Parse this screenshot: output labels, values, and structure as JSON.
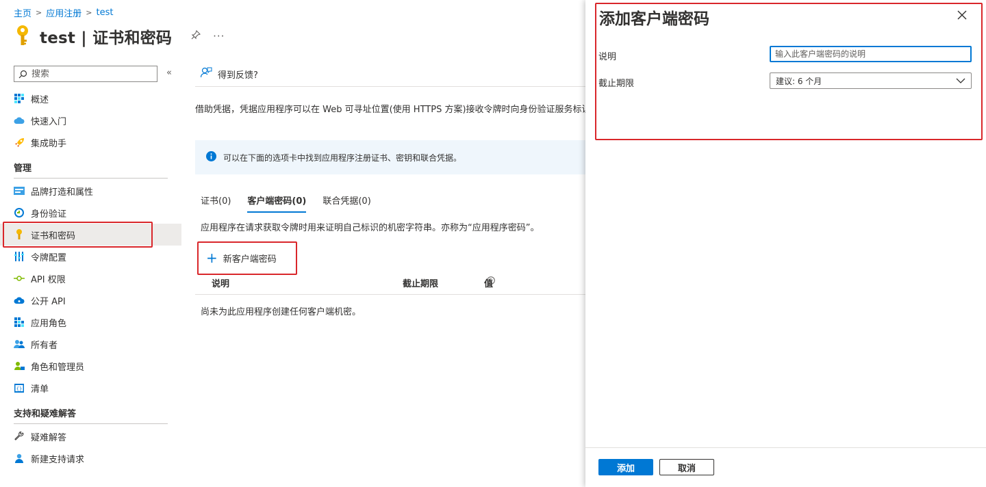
{
  "breadcrumb": {
    "home": "主页",
    "app_reg": "应用注册",
    "current": "test"
  },
  "page": {
    "title": "test | 证书和密码"
  },
  "sidebar": {
    "search_placeholder": "搜索",
    "items_top": [
      {
        "label": "概述",
        "icon": "grid-icon"
      },
      {
        "label": "快速入门",
        "icon": "cloud-icon"
      },
      {
        "label": "集成助手",
        "icon": "rocket-icon"
      }
    ],
    "group_manage": "管理",
    "items_manage": [
      {
        "label": "品牌打造和属性",
        "icon": "branding-icon"
      },
      {
        "label": "身份验证",
        "icon": "auth-icon"
      },
      {
        "label": "证书和密码",
        "icon": "key-icon"
      },
      {
        "label": "令牌配置",
        "icon": "token-icon"
      },
      {
        "label": "API 权限",
        "icon": "api-permission-icon"
      },
      {
        "label": "公开 API",
        "icon": "cloud-api-icon"
      },
      {
        "label": "应用角色",
        "icon": "app-roles-icon"
      },
      {
        "label": "所有者",
        "icon": "owners-icon"
      },
      {
        "label": "角色和管理员",
        "icon": "roles-admin-icon"
      },
      {
        "label": "清单",
        "icon": "manifest-icon"
      }
    ],
    "group_support": "支持和疑难解答",
    "items_support": [
      {
        "label": "疑难解答",
        "icon": "wrench-icon"
      },
      {
        "label": "新建支持请求",
        "icon": "support-person-icon"
      }
    ]
  },
  "main": {
    "feedback": "得到反馈?",
    "description": "借助凭据，凭据应用程序可以在 Web 可寻址位置(使用 HTTPS 方案)接收令牌时向身份验证服务标识自身。为了获得更高级别的保证",
    "info": "可以在下面的选项卡中找到应用程序注册证书、密钥和联合凭据。",
    "tabs": [
      {
        "label": "证书(0)"
      },
      {
        "label": "客户端密码(0)"
      },
      {
        "label": "联合凭据(0)"
      }
    ],
    "tab_description": "应用程序在请求获取令牌时用来证明自己标识的机密字符串。亦称为“应用程序密码”。",
    "new_secret": "新客户端密码",
    "columns": {
      "description": "说明",
      "expires": "截止期限",
      "value": "值"
    },
    "empty_message": "尚未为此应用程序创建任何客户端机密。"
  },
  "panel": {
    "title": "添加客户端密码",
    "description_label": "说明",
    "description_placeholder": "输入此客户端密码的说明",
    "expires_label": "截止期限",
    "expires_value": "建议: 6 个月",
    "add_button": "添加",
    "cancel_button": "取消"
  },
  "colors": {
    "accent": "#0078d4",
    "highlight": "#d9262a",
    "info_bg": "#eff6fc"
  }
}
